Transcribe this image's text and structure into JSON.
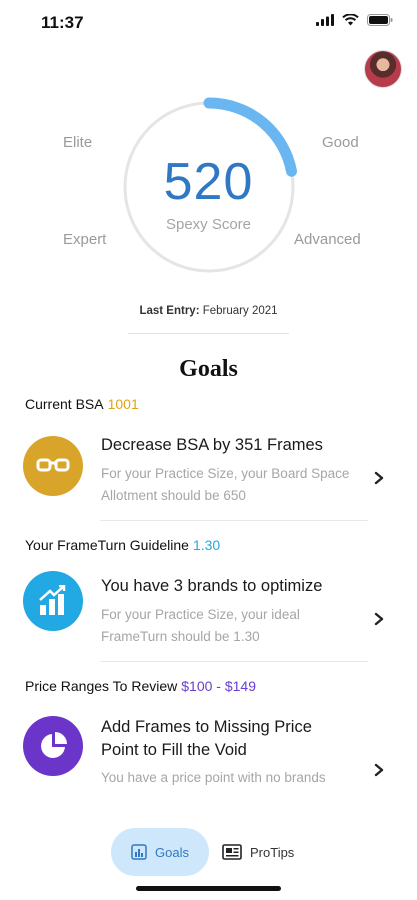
{
  "status": {
    "time": "11:37"
  },
  "score": {
    "value": "520",
    "label": "Spexy Score",
    "progress_fraction": 0.22,
    "levels": {
      "elite": "Elite",
      "good": "Good",
      "expert": "Expert",
      "advanced": "Advanced"
    },
    "accent": "#6ab6f0"
  },
  "last_entry": {
    "label": "Last Entry:",
    "value": "February 2021"
  },
  "goals": {
    "title": "Goals",
    "sections": [
      {
        "heading": "Current BSA",
        "value": "1001",
        "value_color": "#e0a21a",
        "icon": "glasses-icon",
        "icon_bg": "#d9a42a",
        "title": "Decrease BSA by 351 Frames",
        "description": "For your Practice Size, your Board Space Allotment should be 650"
      },
      {
        "heading": "Your FrameTurn Guideline",
        "value": "1.30",
        "value_color": "#2aa6d9",
        "icon": "bar-chart-icon",
        "icon_bg": "#22a8e2",
        "title": "You have 3 brands to optimize",
        "description": "For your Practice Size, your ideal FrameTurn should be 1.30"
      },
      {
        "heading": "Price Ranges To Review",
        "value": "$100 - $149",
        "value_color": "#6a3fd0",
        "icon": "pie-chart-icon",
        "icon_bg": "#6c35c9",
        "title": "Add Frames to Missing Price Point to Fill the Void",
        "description": "You have a price point with no brands"
      }
    ]
  },
  "tabs": [
    {
      "label": "Goals",
      "icon": "chart-icon",
      "active": true
    },
    {
      "label": "ProTips",
      "icon": "newspaper-icon",
      "active": false
    }
  ]
}
